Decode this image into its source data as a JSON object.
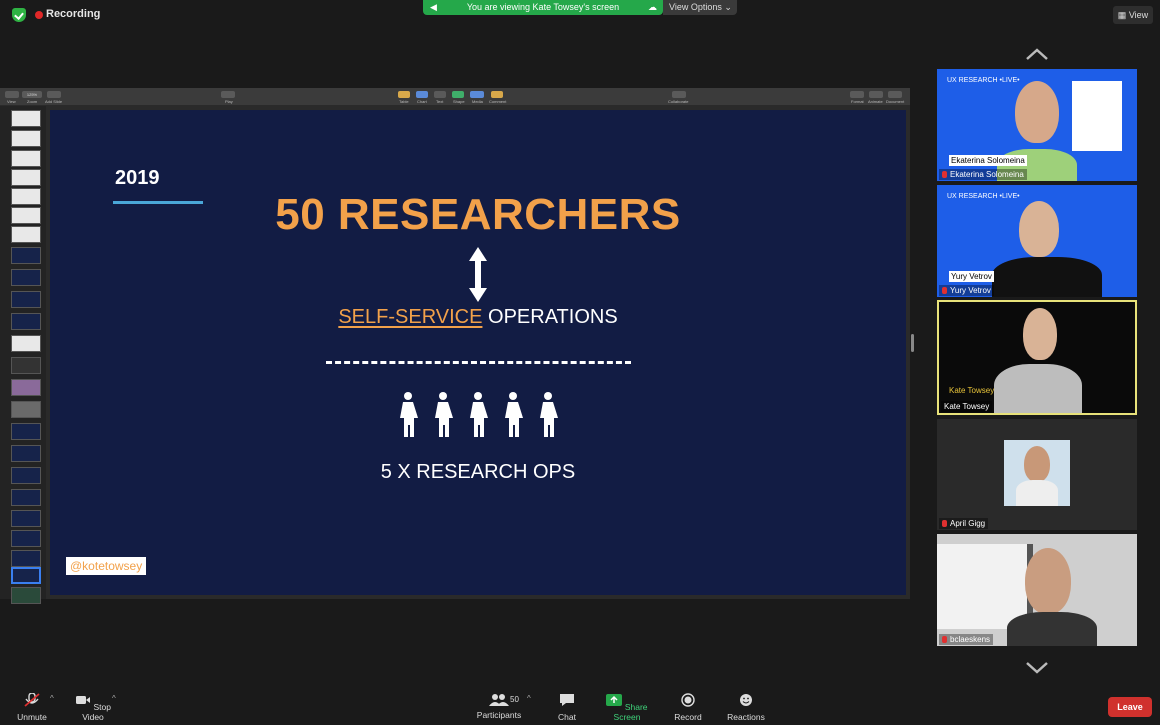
{
  "topbar": {
    "recording_label": "Recording",
    "viewing_banner": "You are viewing Kate Towsey's screen",
    "view_options": "View Options",
    "view_button": "View"
  },
  "keynote": {
    "toolbar": {
      "view": "View",
      "zoom": "Zoom",
      "zoom_value": "125%",
      "add_slide": "Add Slide",
      "play": "Play",
      "table": "Table",
      "chart": "Chart",
      "text": "Text",
      "shape": "Shape",
      "media": "Media",
      "comment": "Comment",
      "collaborate": "Collaborate",
      "format": "Format",
      "animate": "Animate",
      "document": "Document"
    },
    "slide": {
      "year": "2019",
      "title": "50 RESEARCHERS",
      "ops_highlight": "SELF-SERVICE",
      "ops_rest": " OPERATIONS",
      "ratio": "5 X RESEARCH OPS",
      "handle": "@kotetowsey"
    }
  },
  "participants": [
    {
      "name": "Ekaterina Solomeina",
      "slide_name": "Ekaterina Solomeina",
      "brand": "UX RESEARCH •LIVE•"
    },
    {
      "name": "Yury Vetrov",
      "slide_name": "Yury Vetrov",
      "brand": "UX RESEARCH •LIVE•"
    },
    {
      "name": "Kate Towsey",
      "slide_name": "Kate Towsey"
    },
    {
      "name": "April Gigg"
    },
    {
      "name": "bclaeskens"
    }
  ],
  "bottombar": {
    "unmute": "Unmute",
    "stop_video": "Stop Video",
    "participants": "Participants",
    "participant_count": "50",
    "chat": "Chat",
    "share_screen": "Share Screen",
    "record": "Record",
    "reactions": "Reactions",
    "leave": "Leave"
  },
  "colors": {
    "slide_bg": "#121c44",
    "accent_orange": "#f2a14a",
    "share_green": "#25a84a",
    "leave_red": "#d0312d",
    "tile_blue": "#1e5ee8"
  }
}
